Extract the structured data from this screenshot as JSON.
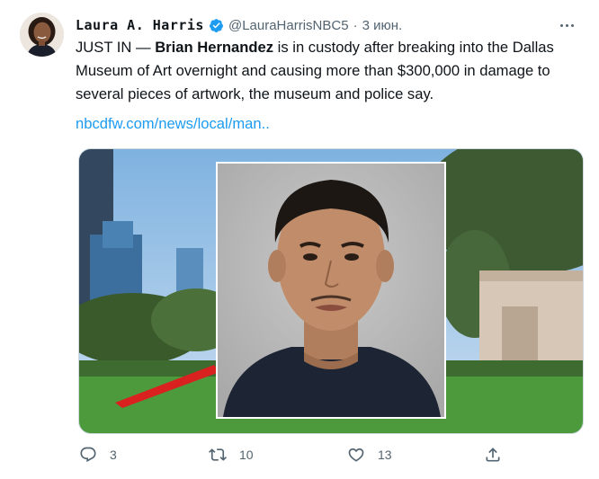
{
  "author": {
    "name": "Laura A. Harris",
    "handle": "@LauraHarrisNBC5",
    "separator": "·",
    "date": "3 июн.",
    "verified": true,
    "accent": "#1d9bf0"
  },
  "tweet": {
    "prefix": "JUST IN — ",
    "bold_name": "Brian Hernandez",
    "body": " is in custody after breaking into the Dallas Museum of Art overnight and causing more than $300,000 in damage to several pieces of artwork, the museum and police say.",
    "link": "nbcdfw.com/news/local/man.."
  },
  "media": {
    "description_icon": "mugshot-over-museum-photo"
  },
  "actions": {
    "reply_count": "3",
    "retweet_count": "10",
    "like_count": "13",
    "icons": [
      "reply-icon",
      "retweet-icon",
      "like-icon",
      "share-icon"
    ]
  }
}
